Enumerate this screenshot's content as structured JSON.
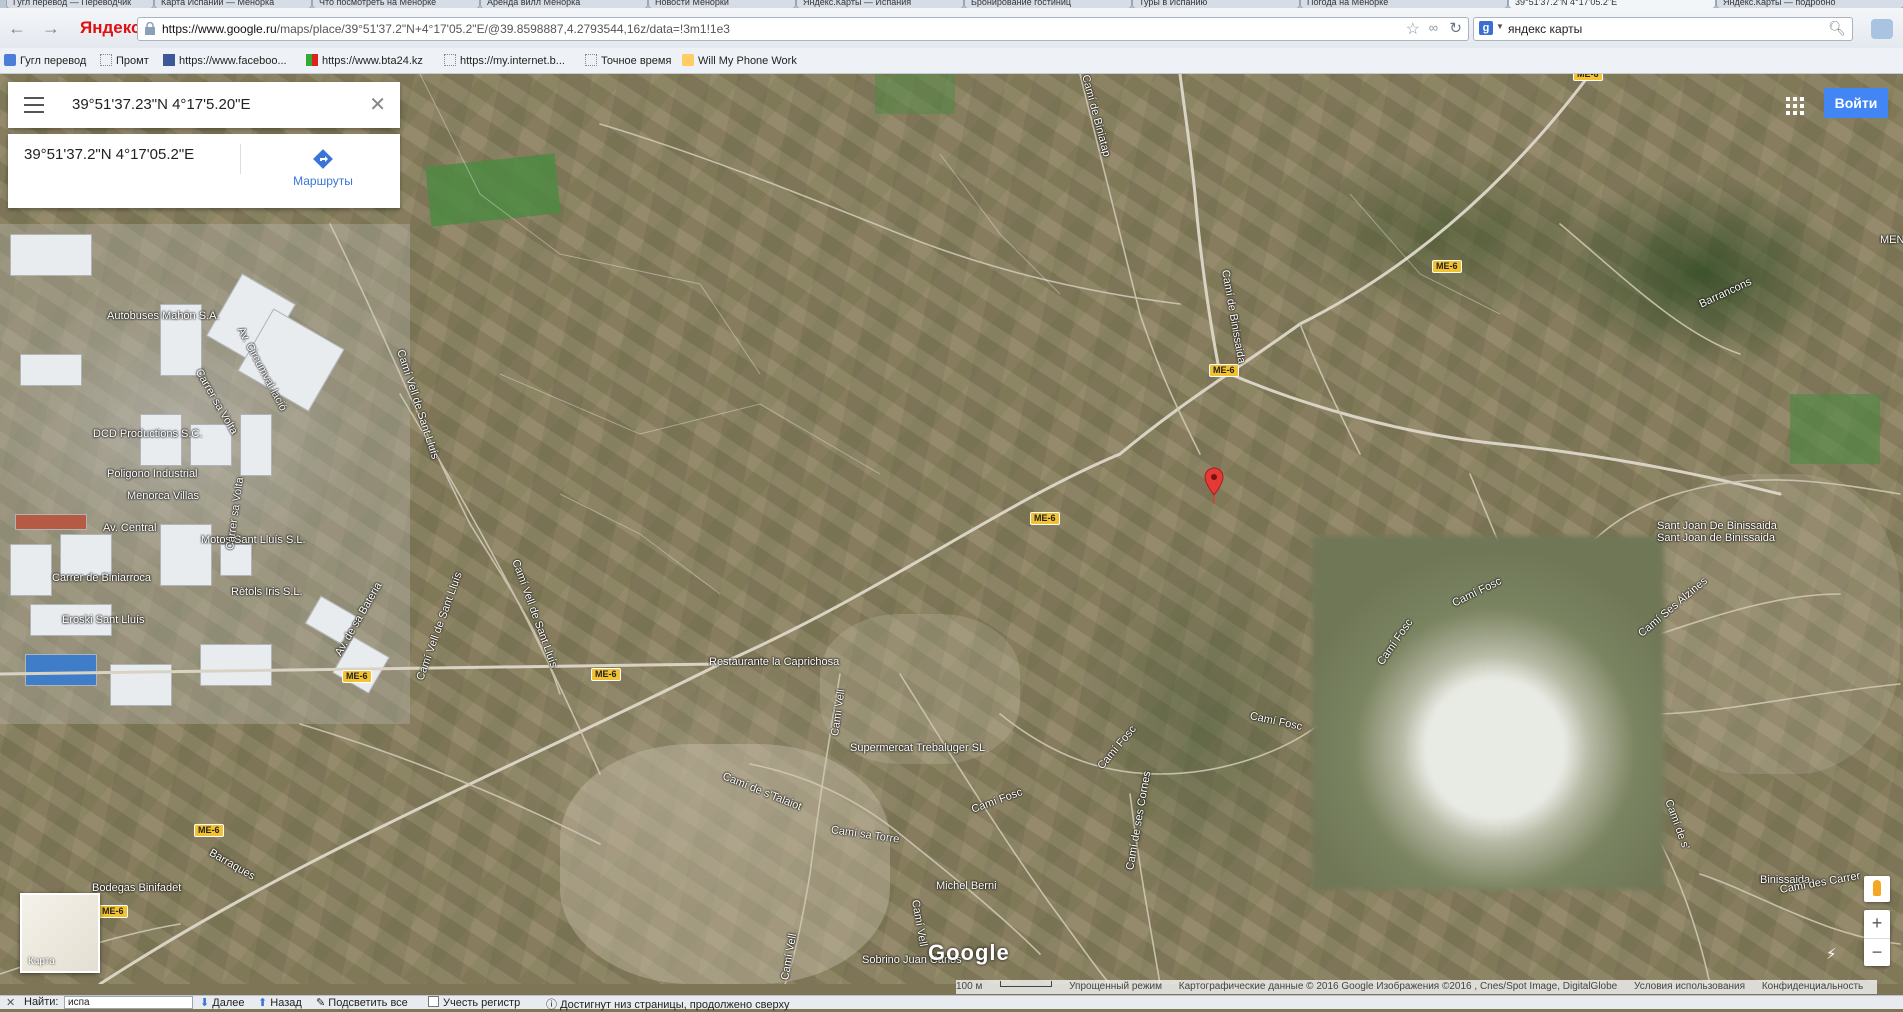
{
  "browser": {
    "tabs": [
      "Гугл перевод — Переводчик",
      "Карта Испании — Менорка",
      "Что посмотреть на Менорке",
      "Аренда вилл Менорка",
      "Новости Менорки",
      "Яндекс.Карты — Испания",
      "Бронирование гостиниц",
      "Туры в Испанию",
      "Погода на Менорке",
      "39°51'37.2\"N 4°17'05.2\"E",
      "Яндекс.Карты — подробно"
    ],
    "brand_logo": "Яндекс",
    "url_host": "https://www.google.ru",
    "url_path": "/maps/place/39°51'37.2\"N+4°17'05.2\"E/@39.8598887,4.2793544,16z/data=!3m1!1e3",
    "search_engine_icon": "google-icon",
    "search_query": "яндекс карты",
    "bookmarks": [
      {
        "label": "Гугл перевод",
        "icon": "translate-icon"
      },
      {
        "label": "Промт",
        "icon": "page-icon"
      },
      {
        "label": "https://www.faceboo...",
        "icon": "facebook-icon"
      },
      {
        "label": "https://www.bta24.kz",
        "icon": "bta-icon"
      },
      {
        "label": "https://my.internet.b...",
        "icon": "page-icon"
      },
      {
        "label": "Точное время",
        "icon": "page-icon"
      },
      {
        "label": "Will My Phone Work",
        "icon": "phone-icon"
      }
    ]
  },
  "maps": {
    "search_value": "39°51'37.23\"N 4°17'5.20\"E",
    "place_coordinates": "39°51'37.2\"N 4°17'05.2\"E",
    "route_label": "Маршруты",
    "login_label": "Войти",
    "layer_label": "Карта",
    "logo": "Google",
    "labels": {
      "autobuses": "Autobuses Mahón S.A.",
      "dcd": "DCD Productions S.C.",
      "poligono": "Poligono Industrial",
      "menorca_villas": "Menorca Villas",
      "av_central": "Av. Central",
      "motos": "Motos Sant Lluís S.L.",
      "biniarroca": "Carrer de Biniarroca",
      "retols": "Rètols Iris S.L.",
      "eroski": "Eroski Sant Lluís",
      "restaurante": "Restaurante la Caprichosa",
      "supermercat": "Supermercat Trebaluger SL",
      "bodegas": "Bodegas Binifadet",
      "michel": "Michel Berni",
      "sobrino": "Sobrino Juan Carlos",
      "sant_joan": "Sant Joan De Binissaida",
      "sant_joan2": "Sant Joan de Binissaida",
      "binissaida": "Binissaida",
      "cami_fosc": "Camí Fosc",
      "cami_fosc2": "Camí Fosc",
      "cami_fosc3": "Camí Fosc",
      "cami_fosc4": "Camí Fosc",
      "cami_fosc5": "Camí Fosc",
      "cami_talaiot": "Camí de s'Talaiot",
      "cami_torre": "Camí sa Torre",
      "cami_vell": "Camí Vell",
      "cami_vell2": "Camí Vell",
      "cami_vell3": "Camí Vell",
      "cami_sant_lluis": "Camí Vell de Sant Lluís",
      "cami_sant_lluis2": "Camí Vell de Sant Lluís",
      "cami_sant_lluis3": "Camí Vell de Sant Lluís",
      "cami_binissaida": "Camí de Binissaida",
      "cami_biniatap": "Camí de Biniatap",
      "cami_cornes": "Camí de ses Cornes",
      "cami_alzines": "Camí Ses Alzines",
      "barrancons": "Barrancons",
      "barraques": "Barraques",
      "av_circumval": "Av. Circumval·lació",
      "carrer_volta": "Carrer sa Volta",
      "av_bateria": "Av. de sa Bateria",
      "cami_de_ses": "Camí de s'",
      "carrer_volta2": "Carrer sa Volta",
      "cami_carrer": "Camí des Carrer",
      "mahon_edge": "MENO"
    },
    "road_shield": "ME-6",
    "footer": {
      "scale": "100 м",
      "simple_mode": "Упрощенный режим",
      "attribution": "Картографические данные © 2016 Google Изображения ©2016 , Cnes/Spot Image, DigitalGlobe",
      "terms": "Условия использования",
      "privacy": "Конфиденциальность"
    }
  },
  "findbar": {
    "label": "Найти:",
    "value": "испа",
    "next": "Далее",
    "prev": "Назад",
    "highlight_all": "Подсветить все",
    "match_case": "Учесть регистр",
    "status": "Достигнут низ страницы, продолжено сверху"
  }
}
